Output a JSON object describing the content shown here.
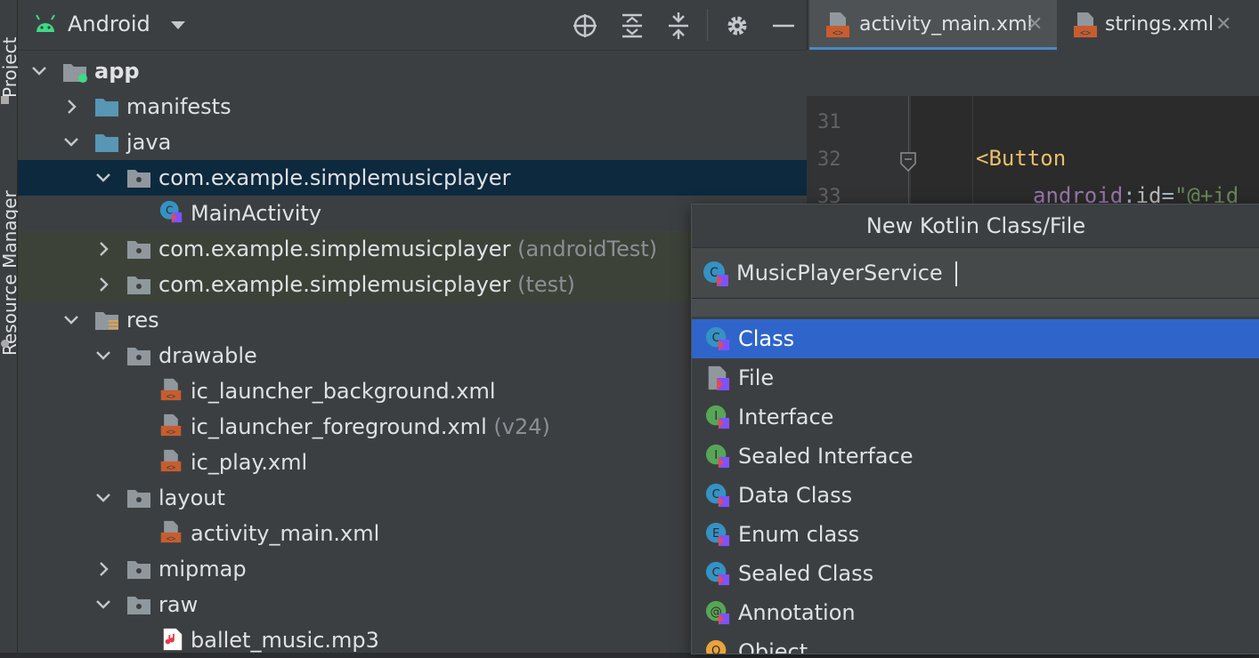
{
  "sidebar": {
    "project_label": "Project",
    "resource_label": "Resource Manager"
  },
  "project_panel": {
    "view_selector": "Android",
    "tree": [
      {
        "label": "app",
        "suffix": "",
        "icon": "module-icon",
        "expanded": true
      },
      {
        "label": "manifests",
        "suffix": "",
        "icon": "folder-icon",
        "expanded": false
      },
      {
        "label": "java",
        "suffix": "",
        "icon": "folder-icon",
        "expanded": true
      },
      {
        "label": "com.example.simplemusicplayer",
        "suffix": "",
        "icon": "package-icon",
        "expanded": true
      },
      {
        "label": "MainActivity",
        "suffix": "",
        "icon": "kotlin-class-icon"
      },
      {
        "label": "com.example.simplemusicplayer",
        "suffix": "(androidTest)",
        "icon": "package-icon",
        "expanded": false
      },
      {
        "label": "com.example.simplemusicplayer",
        "suffix": "(test)",
        "icon": "package-icon",
        "expanded": false
      },
      {
        "label": "res",
        "suffix": "",
        "icon": "res-folder-icon",
        "expanded": true
      },
      {
        "label": "drawable",
        "suffix": "",
        "icon": "package-icon",
        "expanded": true
      },
      {
        "label": "ic_launcher_background.xml",
        "suffix": "",
        "icon": "xml-file-icon"
      },
      {
        "label": "ic_launcher_foreground.xml",
        "suffix": "(v24)",
        "icon": "xml-file-icon"
      },
      {
        "label": "ic_play.xml",
        "suffix": "",
        "icon": "xml-file-icon"
      },
      {
        "label": "layout",
        "suffix": "",
        "icon": "package-icon",
        "expanded": true
      },
      {
        "label": "activity_main.xml",
        "suffix": "",
        "icon": "xml-file-icon"
      },
      {
        "label": "mipmap",
        "suffix": "",
        "icon": "package-icon",
        "expanded": false
      },
      {
        "label": "raw",
        "suffix": "",
        "icon": "package-icon",
        "expanded": true
      },
      {
        "label": "ballet_music.mp3",
        "suffix": "",
        "icon": "audio-file-icon"
      }
    ]
  },
  "editor": {
    "tabs": [
      {
        "label": "activity_main.xml",
        "close": "✕"
      },
      {
        "label": "strings.xml",
        "close": "✕"
      }
    ],
    "line_numbers": [
      "31",
      "32",
      "33"
    ],
    "code_button": "<Button",
    "code_attr": "android",
    "code_colon": ":",
    "code_id": "id",
    "code_eq": "=",
    "code_value": "\"@+id"
  },
  "dialog": {
    "title": "New Kotlin Class/File",
    "name_value": "MusicPlayerService",
    "options": [
      {
        "label": "Class",
        "icon": "class-icon"
      },
      {
        "label": "File",
        "icon": "file-icon"
      },
      {
        "label": "Interface",
        "icon": "interface-icon"
      },
      {
        "label": "Sealed Interface",
        "icon": "sealed-interface-icon"
      },
      {
        "label": "Data Class",
        "icon": "data-class-icon"
      },
      {
        "label": "Enum class",
        "icon": "enum-class-icon"
      },
      {
        "label": "Sealed Class",
        "icon": "sealed-class-icon"
      },
      {
        "label": "Annotation",
        "icon": "annotation-icon"
      },
      {
        "label": "Object",
        "icon": "object-icon"
      }
    ]
  },
  "colors": {
    "selection": "#2f65ca",
    "tree_selected": "#0d293e",
    "test_bg": "#3d4239",
    "keyword": "#e8bf6a",
    "attr": "#9876aa",
    "string": "#6a8759"
  }
}
